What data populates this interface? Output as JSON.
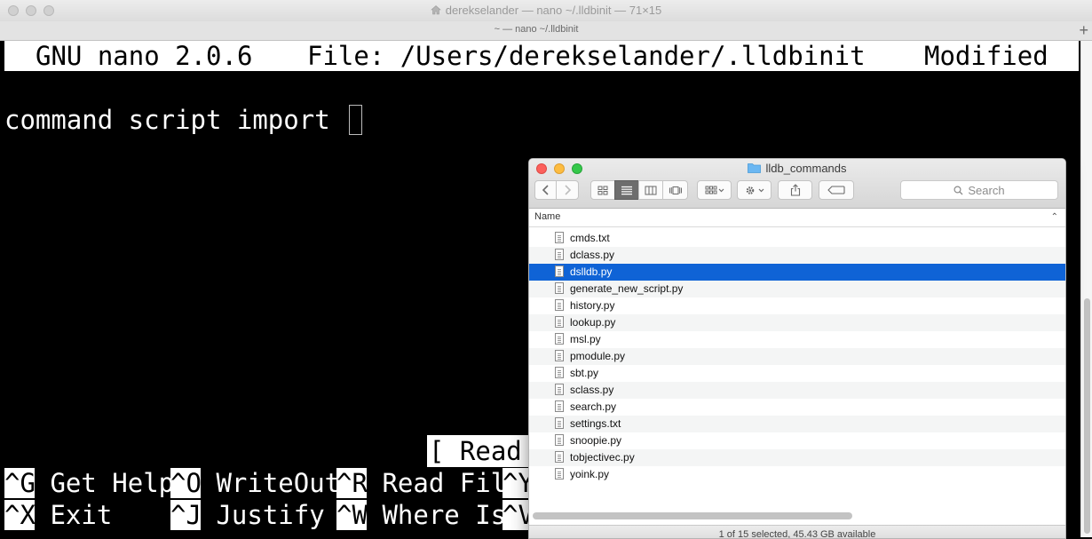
{
  "terminal": {
    "title": "derekselander — nano ~/.lldbinit — 71×15",
    "tab_title": "~ — nano ~/.lldbinit",
    "new_tab_label": "+",
    "nano": {
      "version": "GNU nano 2.0.6",
      "file_label": "File: /Users/derekselander/.lldbinit",
      "modified": "Modified",
      "edit_line": "command script import ",
      "status_msg": "[ Read",
      "shortcuts_row1": [
        {
          "key": "^G",
          "label": " Get Help"
        },
        {
          "key": "^O",
          "label": " WriteOut"
        },
        {
          "key": "^R",
          "label": " Read Fil"
        },
        {
          "key": "^Y",
          "label": ""
        }
      ],
      "shortcuts_row2": [
        {
          "key": "^X",
          "label": " Exit"
        },
        {
          "key": "^J",
          "label": " Justify"
        },
        {
          "key": "^W",
          "label": " Where Is"
        },
        {
          "key": "^V",
          "label": ""
        }
      ]
    }
  },
  "finder": {
    "title": "lldb_commands",
    "search_placeholder": "Search",
    "column_name": "Name",
    "selected_color": "#0f63d6",
    "files": [
      "cmds.txt",
      "dclass.py",
      "dslldb.py",
      "generate_new_script.py",
      "history.py",
      "lookup.py",
      "msl.py",
      "pmodule.py",
      "sbt.py",
      "sclass.py",
      "search.py",
      "settings.txt",
      "snoopie.py",
      "tobjectivec.py",
      "yoink.py"
    ],
    "selected_index": 2,
    "status": "1 of 15 selected, 45.43 GB available"
  }
}
